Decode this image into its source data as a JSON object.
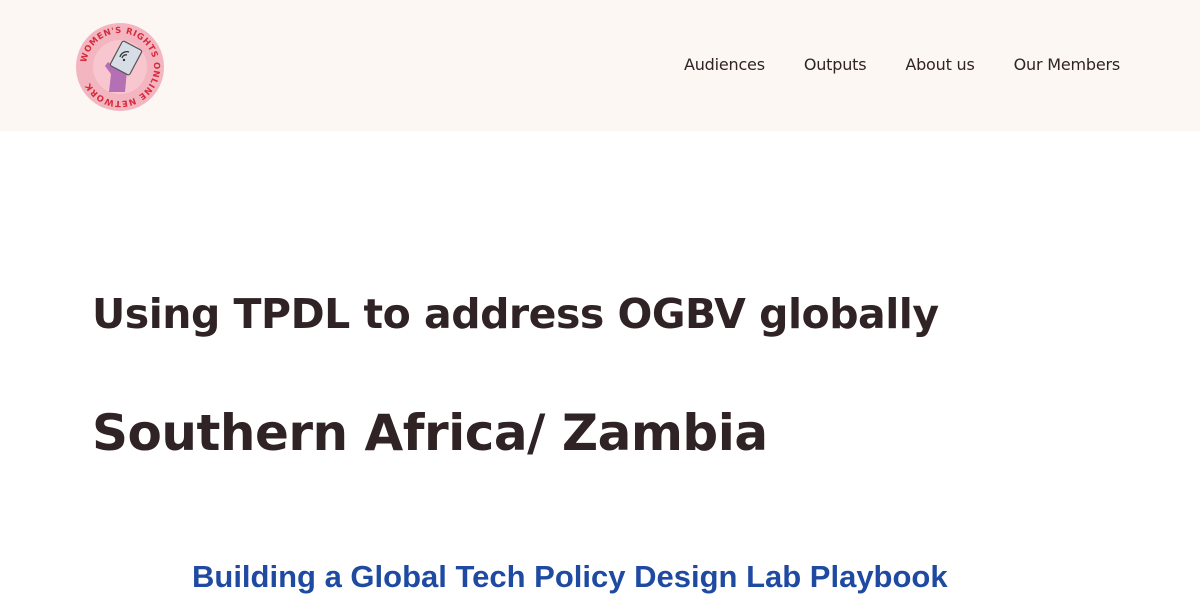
{
  "header": {
    "logo": {
      "text": "WOMEN'S RIGHTS ONLINE NETWORK",
      "icon": "hand-holding-phone-icon",
      "colors": {
        "ring": "#f3b6c1",
        "ring_text": "#d62b3b",
        "hand": "#b56fb4"
      }
    },
    "nav": [
      {
        "label": "Audiences"
      },
      {
        "label": "Outputs"
      },
      {
        "label": "About us"
      },
      {
        "label": "Our Members"
      }
    ]
  },
  "main": {
    "heading": "Using TPDL to address OGBV globally",
    "region_heading": "Southern Africa/ Zambia",
    "embedded_image_title": "Building a Global Tech Policy Design Lab Playbook"
  },
  "colors": {
    "header_bg": "#fdf7f3",
    "text": "#2f2325",
    "playbook_blue": "#1f4aa2"
  }
}
